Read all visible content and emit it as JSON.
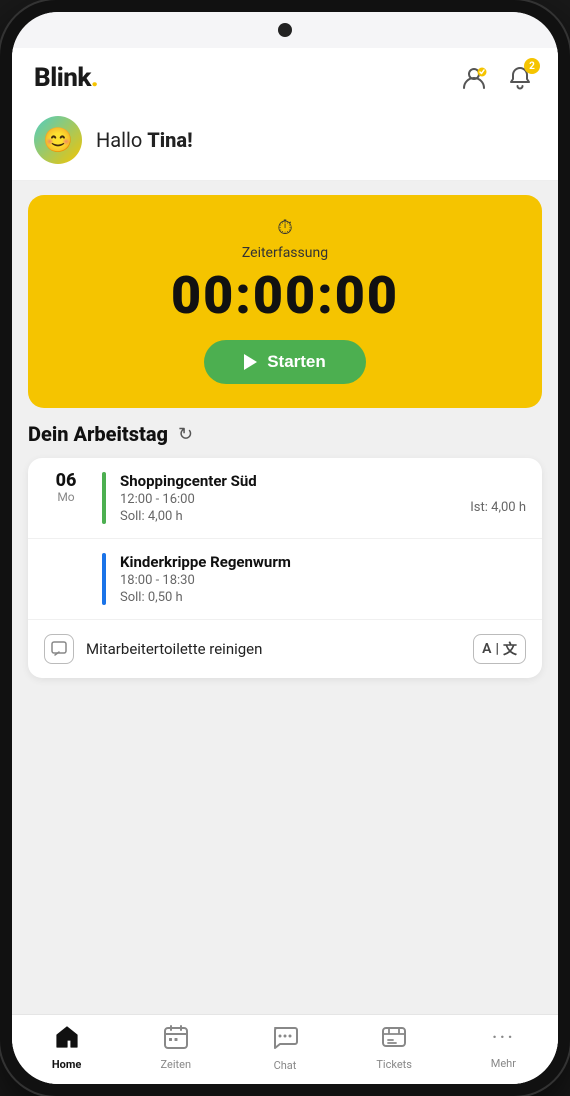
{
  "app": {
    "logo": "Blink.",
    "logo_main": "Blink",
    "logo_dot": "."
  },
  "header": {
    "notification_count": "2"
  },
  "greeting": {
    "text": "Hallo ",
    "name": "Tina!",
    "avatar_emoji": "😊"
  },
  "timer": {
    "label": "Zeiterfassung",
    "display": "00:00:00",
    "start_button": "Starten"
  },
  "workday": {
    "title": "Dein Arbeitstag",
    "entries": [
      {
        "date_number": "06",
        "date_day": "Mo",
        "bar_color": "green",
        "title": "Shoppingcenter Süd",
        "time": "12:00 - 16:00",
        "soll": "Soll: 4,00 h",
        "ist": "Ist: 4,00 h"
      },
      {
        "date_number": "",
        "date_day": "",
        "bar_color": "blue",
        "title": "Kinderkrippe Regenwurm",
        "time": "18:00 - 18:30",
        "soll": "Soll: 0,50 h",
        "ist": ""
      }
    ],
    "task": {
      "text": "Mitarbeitertoilette reinigen",
      "translate_label": "A",
      "translate_icon": "✕"
    }
  },
  "bottom_nav": {
    "items": [
      {
        "label": "Home",
        "icon": "🏠",
        "active": true
      },
      {
        "label": "Zeiten",
        "icon": "📅",
        "active": false
      },
      {
        "label": "Chat",
        "icon": "💬",
        "active": false
      },
      {
        "label": "Tickets",
        "icon": "🎫",
        "active": false
      },
      {
        "label": "Mehr",
        "icon": "•••",
        "active": false
      }
    ]
  }
}
